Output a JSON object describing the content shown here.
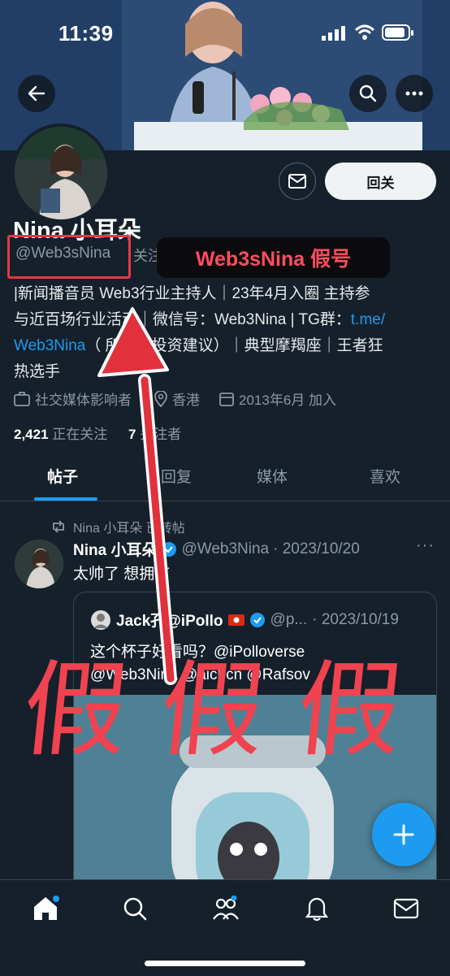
{
  "status": {
    "time": "11:39"
  },
  "profile": {
    "display_name": "Nina 小耳朵",
    "handle": "@Web3sNina",
    "follows_you": "关注了你",
    "follow_button": "回关",
    "bio_line1": "|新闻播音员  Web3行业主持人｜23年4月入圈 主持参",
    "bio_line2a": "与近百场行业活动｜微信号：Web3Nina | TG群：",
    "bio_link1": "t.me/",
    "bio_link2": "Web3Nina",
    "bio_line3b": "（ 所有非投资建议）｜典型摩羯座｜王者狂",
    "bio_line4": "热选手",
    "category": "社交媒体影响者",
    "location": "香港",
    "joined": "2013年6月 加入",
    "following_count": "2,421",
    "following_label": "正在关注",
    "followers_count": "7",
    "followers_label": "关注者"
  },
  "annotation": {
    "fake_label": "Web3sNina 假号",
    "big_fake": "假 假 假"
  },
  "tabs": [
    {
      "label": "帖子",
      "active": true
    },
    {
      "label": "回复"
    },
    {
      "label": "媒体"
    },
    {
      "label": "喜欢"
    }
  ],
  "post": {
    "repost_by": "Nina 小耳朵 已转帖",
    "author_name": "Nina 小耳朵",
    "author_handle": "@Web3Nina",
    "date": "· 2023/10/20",
    "text": "太帅了 想拥有",
    "more": "···"
  },
  "quote": {
    "author_name": "Jack孔@iPollo",
    "author_handle": "@p...",
    "date": "· 2023/10/19",
    "text_line1": "这个杯子好看吗？@iPolloverse",
    "text_line2": "@Web3Nina @aicbcn @Rafsov"
  },
  "colors": {
    "background": "#15202b",
    "accent": "#1d9bf0",
    "annotation_red": "#e63946"
  },
  "icons": [
    "back-arrow-icon",
    "search-icon",
    "more-icon",
    "mail-icon",
    "briefcase-icon",
    "location-icon",
    "calendar-icon",
    "repost-icon",
    "verified-icon",
    "plus-icon",
    "home-icon",
    "search-nav-icon",
    "communities-icon",
    "bell-icon",
    "messages-icon"
  ]
}
